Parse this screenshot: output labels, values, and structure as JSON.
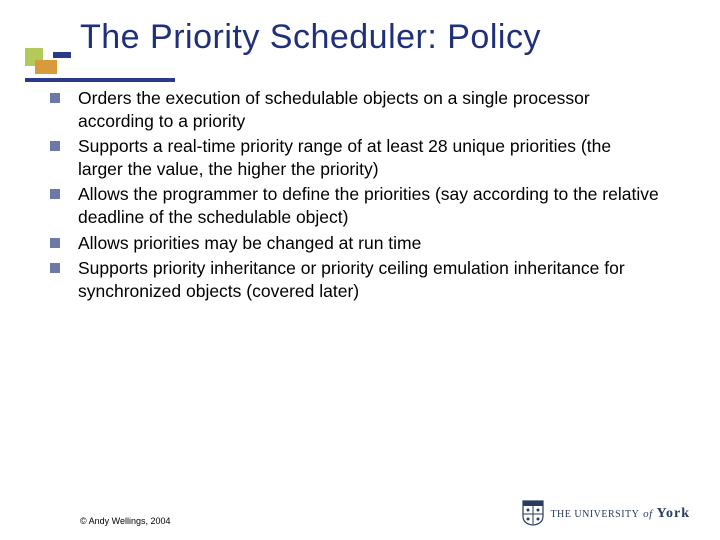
{
  "title": "The Priority Scheduler: Policy",
  "bullets": [
    "Orders the execution of schedulable objects on a single processor according to a priority",
    "Supports a real-time priority range of at least 28 unique priorities (the larger the value, the higher the priority)",
    "Allows the programmer to define the priorities (say according to the relative deadline of the schedulable object)",
    "Allows priorities may be changed at run time",
    "Supports priority inheritance or priority ceiling emulation inheritance for synchronized objects (covered later)"
  ],
  "copyright": "© Andy Wellings, 2004",
  "logo": {
    "prefix": "THE UNIVERSITY",
    "of": "of",
    "name": "York"
  }
}
